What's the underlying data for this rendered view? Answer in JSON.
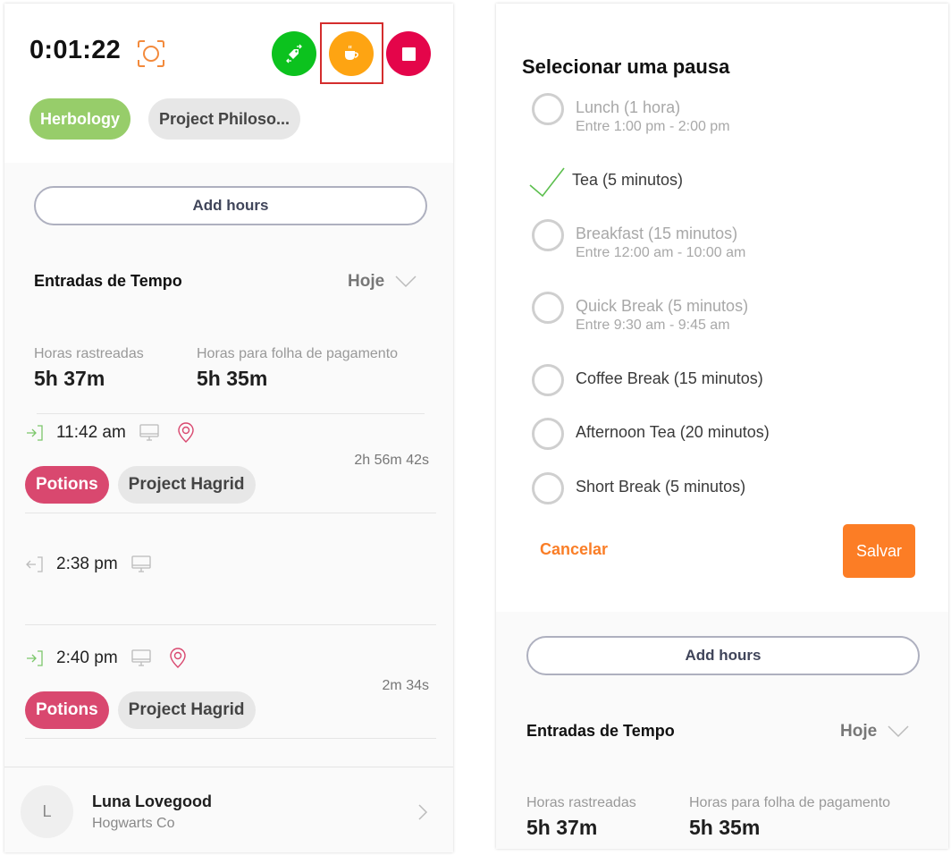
{
  "timer": {
    "elapsed": "0:01:22",
    "tags": [
      "Herbology",
      "Project Philoso..."
    ]
  },
  "actions": {
    "switch": "switch-task",
    "break": "take-break",
    "stop": "stop-timer"
  },
  "colors": {
    "switch_green": "#0cc21e",
    "break_orange": "#fea412",
    "stop_red": "#e4054a",
    "accent_orange": "#fc7d25",
    "tag_pink": "#d9486f",
    "tag_green": "#97cd6a",
    "highlight_red": "#d42d2d"
  },
  "left": {
    "add_hours": "Add hours",
    "section_title": "Entradas de Tempo",
    "range": "Hoje",
    "stats": {
      "tracked_label": "Horas rastreadas",
      "tracked_value": "5h 37m",
      "payroll_label": "Horas para folha de pagamento",
      "payroll_value": "5h 35m"
    },
    "entries": [
      {
        "direction": "in",
        "time": "11:42 am",
        "device": "desktop",
        "location": true,
        "duration": "2h 56m 42s",
        "tags": [
          "Potions",
          "Project Hagrid"
        ]
      },
      {
        "direction": "out",
        "time": "2:38 pm",
        "device": "desktop",
        "location": false,
        "duration": "",
        "tags": []
      },
      {
        "direction": "in",
        "time": "2:40 pm",
        "device": "desktop",
        "location": true,
        "duration": "2m 34s",
        "tags": [
          "Potions",
          "Project Hagrid"
        ]
      }
    ],
    "user": {
      "initial": "L",
      "name": "Luna Lovegood",
      "company": "Hogwarts Co"
    }
  },
  "break_dialog": {
    "title": "Selecionar uma pausa",
    "options": [
      {
        "name": "Lunch (1 hora)",
        "window": "Entre 1:00 pm - 2:00 pm",
        "enabled": false,
        "selected": false
      },
      {
        "name": "Tea (5 minutos)",
        "window": "",
        "enabled": true,
        "selected": true
      },
      {
        "name": "Breakfast (15 minutos)",
        "window": "Entre 12:00 am - 10:00 am",
        "enabled": false,
        "selected": false
      },
      {
        "name": "Quick Break (5 minutos)",
        "window": "Entre 9:30 am - 9:45 am",
        "enabled": false,
        "selected": false
      },
      {
        "name": "Coffee Break (15 minutos)",
        "window": "",
        "enabled": true,
        "selected": false
      },
      {
        "name": "Afternoon Tea (20 minutos)",
        "window": "",
        "enabled": true,
        "selected": false
      },
      {
        "name": "Short Break (5 minutos)",
        "window": "",
        "enabled": true,
        "selected": false
      }
    ],
    "cancel": "Cancelar",
    "save": "Salvar"
  },
  "right": {
    "add_hours": "Add hours",
    "section_title": "Entradas de Tempo",
    "range": "Hoje",
    "stats": {
      "tracked_label": "Horas rastreadas",
      "tracked_value": "5h 37m",
      "payroll_label": "Horas para folha de pagamento",
      "payroll_value": "5h 35m"
    }
  }
}
